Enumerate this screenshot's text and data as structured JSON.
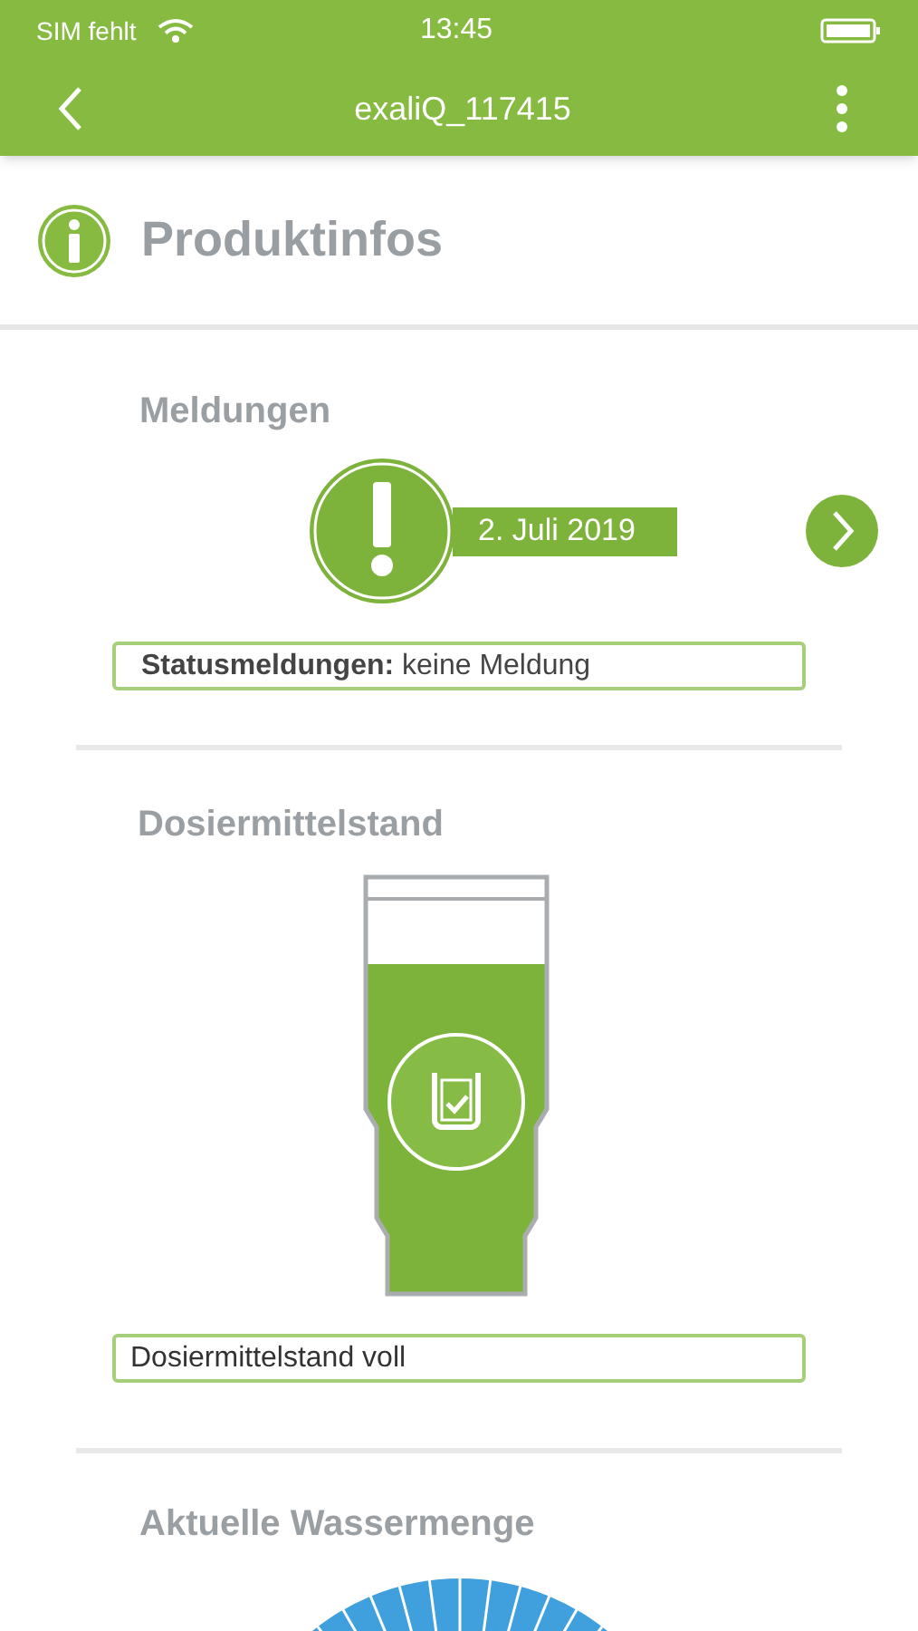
{
  "status_bar": {
    "carrier": "SIM fehlt",
    "time": "13:45"
  },
  "nav_bar": {
    "title": "exaliQ_117415"
  },
  "header": {
    "title": "Produktinfos"
  },
  "messages": {
    "heading": "Meldungen",
    "date": "2. Juli 2019",
    "status": "**Statusmeldungen:** keine Meldung"
  },
  "dosing": {
    "heading": "Dosiermittelstand",
    "status": "Dosiermittelstand voll"
  },
  "water": {
    "heading": "Aktuelle Wassermenge"
  }
}
